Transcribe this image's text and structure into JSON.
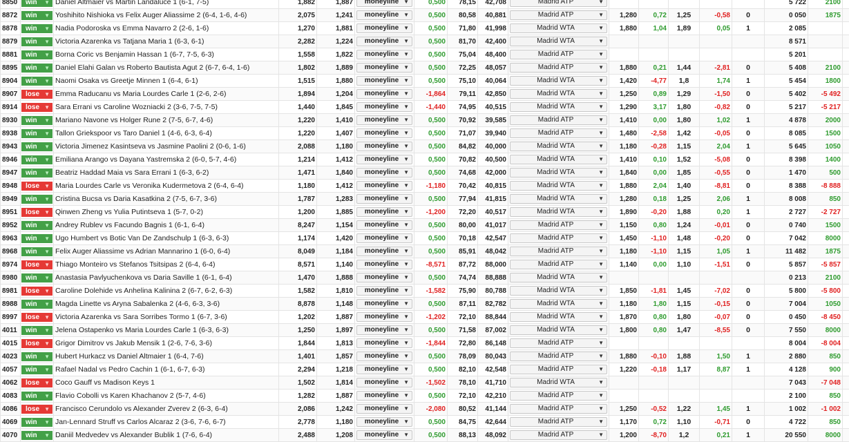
{
  "dropdown_icon": "chevron-down-icon",
  "colors": {
    "win": "#43a047",
    "lose": "#e53935",
    "positive": "#2e9b2e",
    "negative": "#e02020"
  },
  "rows": [
    {
      "id": "8850",
      "result": "win",
      "match": "Daniel Altmaier vs Martin Landaluce 1 (6-1, 7-5)",
      "a": "1,882",
      "b": "1,887",
      "market": "moneyline",
      "c": "0,500",
      "d": "78,15",
      "e": "42,708",
      "tournament": "Madrid ATP",
      "f": "",
      "g": "",
      "h": "",
      "i": "",
      "j": "",
      "k": "5 722",
      "l": "2100"
    },
    {
      "id": "8872",
      "result": "win",
      "match": "Yoshihito Nishioka vs Felix Auger Aliassime 2 (6-4, 1-6, 4-6)",
      "a": "2,075",
      "b": "1,241",
      "market": "moneyline",
      "c": "0,500",
      "d": "80,58",
      "e": "40,881",
      "tournament": "Madrid ATP",
      "f": "1,280",
      "g": "0,72",
      "h": "1,25",
      "i": "-0,58",
      "j": "0",
      "k": "0 050",
      "l": "1875"
    },
    {
      "id": "8878",
      "result": "win",
      "match": "Nadia Podoroska vs Emma Navarro 2 (2-6, 1-6)",
      "a": "1,270",
      "b": "1,881",
      "market": "moneyline",
      "c": "0,500",
      "d": "71,80",
      "e": "41,998",
      "tournament": "Madrid WTA",
      "f": "1,880",
      "g": "1,04",
      "h": "1,89",
      "i": "0,05",
      "j": "1",
      "k": "2 085",
      "l": ""
    },
    {
      "id": "8879",
      "result": "win",
      "match": "Victoria Azarenka vs Tatjana Maria 1 (6-3, 6-1)",
      "a": "2,282",
      "b": "1,224",
      "market": "moneyline",
      "c": "0,500",
      "d": "81,70",
      "e": "42,400",
      "tournament": "Madrid WTA",
      "f": "",
      "g": "",
      "h": "",
      "i": "",
      "j": "",
      "k": "8 571",
      "l": ""
    },
    {
      "id": "8881",
      "result": "win",
      "match": "Borna Coric vs Benjamin Hassan 1 (6-7, 7-5, 6-3)",
      "a": "1,558",
      "b": "1,822",
      "market": "moneyline",
      "c": "0,500",
      "d": "75,04",
      "e": "48,400",
      "tournament": "Madrid ATP",
      "f": "",
      "g": "",
      "h": "",
      "i": "",
      "j": "",
      "k": "5 201",
      "l": ""
    },
    {
      "id": "8895",
      "result": "win",
      "match": "Daniel Elahi Galan vs Roberto Bautista Agut 2 (6-7, 6-4, 1-6)",
      "a": "1,802",
      "b": "1,889",
      "market": "moneyline",
      "c": "0,500",
      "d": "72,25",
      "e": "48,057",
      "tournament": "Madrid ATP",
      "f": "1,880",
      "g": "0,21",
      "h": "1,44",
      "i": "-2,81",
      "j": "0",
      "k": "5 408",
      "l": "2100"
    },
    {
      "id": "8904",
      "result": "win",
      "match": "Naomi Osaka vs Greetje Minnen 1 (6-4, 6-1)",
      "a": "1,515",
      "b": "1,880",
      "market": "moneyline",
      "c": "0,500",
      "d": "75,10",
      "e": "40,064",
      "tournament": "Madrid WTA",
      "f": "1,420",
      "g": "-4,77",
      "h": "1,8",
      "i": "1,74",
      "j": "1",
      "k": "5 454",
      "l": "1800"
    },
    {
      "id": "8907",
      "result": "lose",
      "match": "Emma Raducanu vs Maria Lourdes Carle 1 (2-6, 2-6)",
      "a": "1,894",
      "b": "1,204",
      "market": "moneyline",
      "c": "-1,864",
      "d": "79,11",
      "e": "42,850",
      "tournament": "Madrid WTA",
      "f": "1,250",
      "g": "0,89",
      "h": "1,29",
      "i": "-1,50",
      "j": "0",
      "k": "5 402",
      "l": "-5 492"
    },
    {
      "id": "8914",
      "result": "lose",
      "match": "Sara Errani vs Caroline Wozniacki 2 (3-6, 7-5, 7-5)",
      "a": "1,440",
      "b": "1,845",
      "market": "moneyline",
      "c": "-1,440",
      "d": "74,95",
      "e": "40,515",
      "tournament": "Madrid WTA",
      "f": "1,290",
      "g": "3,17",
      "h": "1,80",
      "i": "-0,82",
      "j": "0",
      "k": "5 217",
      "l": "-5 217"
    },
    {
      "id": "8930",
      "result": "win",
      "match": "Mariano Navone vs Holger Rune 2 (7-5, 6-7, 4-6)",
      "a": "1,220",
      "b": "1,410",
      "market": "moneyline",
      "c": "0,500",
      "d": "70,92",
      "e": "39,585",
      "tournament": "Madrid ATP",
      "f": "1,410",
      "g": "0,00",
      "h": "1,80",
      "i": "1,02",
      "j": "1",
      "k": "4 878",
      "l": "2000"
    },
    {
      "id": "8938",
      "result": "win",
      "match": "Tallon Griekspoor vs Taro Daniel 1 (4-6, 6-3, 6-4)",
      "a": "1,220",
      "b": "1,407",
      "market": "moneyline",
      "c": "0,500",
      "d": "71,07",
      "e": "39,940",
      "tournament": "Madrid ATP",
      "f": "1,480",
      "g": "-2,58",
      "h": "1,42",
      "i": "-0,05",
      "j": "0",
      "k": "8 085",
      "l": "1500"
    },
    {
      "id": "8943",
      "result": "win",
      "match": "Victoria Jimenez Kasintseva vs Jasmine Paolini 2 (0-6, 1-6)",
      "a": "2,088",
      "b": "1,180",
      "market": "moneyline",
      "c": "0,500",
      "d": "84,82",
      "e": "40,000",
      "tournament": "Madrid WTA",
      "f": "1,180",
      "g": "-0,28",
      "h": "1,15",
      "i": "2,04",
      "j": "1",
      "k": "5 645",
      "l": "1050"
    },
    {
      "id": "8946",
      "result": "win",
      "match": "Emiliana Arango vs Dayana Yastremska 2 (6-0, 5-7, 4-6)",
      "a": "1,214",
      "b": "1,412",
      "market": "moneyline",
      "c": "0,500",
      "d": "70,82",
      "e": "40,500",
      "tournament": "Madrid WTA",
      "f": "1,410",
      "g": "0,10",
      "h": "1,52",
      "i": "-5,08",
      "j": "0",
      "k": "8 398",
      "l": "1400"
    },
    {
      "id": "8947",
      "result": "win",
      "match": "Beatriz Haddad Maia vs Sara Errani 1 (6-3, 6-2)",
      "a": "1,471",
      "b": "1,840",
      "market": "moneyline",
      "c": "0,500",
      "d": "74,68",
      "e": "42,000",
      "tournament": "Madrid WTA",
      "f": "1,840",
      "g": "0,00",
      "h": "1,85",
      "i": "-0,55",
      "j": "0",
      "k": "1 470",
      "l": "500"
    },
    {
      "id": "8948",
      "result": "lose",
      "match": "Maria Lourdes Carle vs Veronika Kudermetova 2 (6-4, 6-4)",
      "a": "1,180",
      "b": "1,412",
      "market": "moneyline",
      "c": "-1,180",
      "d": "70,42",
      "e": "40,815",
      "tournament": "Madrid WTA",
      "f": "1,880",
      "g": "2,04",
      "h": "1,40",
      "i": "-8,81",
      "j": "0",
      "k": "8 388",
      "l": "-8 888"
    },
    {
      "id": "8949",
      "result": "win",
      "match": "Cristina Bucsa vs Daria Kasatkina 2 (7-5, 6-7, 3-6)",
      "a": "1,787",
      "b": "1,283",
      "market": "moneyline",
      "c": "0,500",
      "d": "77,94",
      "e": "41,815",
      "tournament": "Madrid WTA",
      "f": "1,280",
      "g": "0,18",
      "h": "1,25",
      "i": "2,06",
      "j": "1",
      "k": "8 008",
      "l": "850"
    },
    {
      "id": "8951",
      "result": "lose",
      "match": "Qinwen Zheng vs Yulia Putintseva 1 (5-7, 0-2)",
      "a": "1,200",
      "b": "1,885",
      "market": "moneyline",
      "c": "-1,200",
      "d": "72,20",
      "e": "40,517",
      "tournament": "Madrid WTA",
      "f": "1,890",
      "g": "-0,20",
      "h": "1,88",
      "i": "0,20",
      "j": "1",
      "k": "2 727",
      "l": "-2 727"
    },
    {
      "id": "8952",
      "result": "win",
      "match": "Andrey Rublev vs Facundo Bagnis 1 (6-1, 6-4)",
      "a": "8,247",
      "b": "1,154",
      "market": "moneyline",
      "c": "0,500",
      "d": "80,00",
      "e": "41,017",
      "tournament": "Madrid ATP",
      "f": "1,150",
      "g": "0,80",
      "h": "1,24",
      "i": "-0,01",
      "j": "0",
      "k": "0 740",
      "l": "1500"
    },
    {
      "id": "8963",
      "result": "win",
      "match": "Ugo Humbert vs Botic Van De Zandschulp 1 (6-3, 6-3)",
      "a": "1,174",
      "b": "1,420",
      "market": "moneyline",
      "c": "0,500",
      "d": "70,18",
      "e": "42,547",
      "tournament": "Madrid ATP",
      "f": "1,450",
      "g": "-1,10",
      "h": "1,48",
      "i": "-0,20",
      "j": "0",
      "k": "7 042",
      "l": "8000"
    },
    {
      "id": "8968",
      "result": "win",
      "match": "Felix Auger Aliassime vs Adrian Mannarino 1 (6-0, 6-4)",
      "a": "8,049",
      "b": "1,184",
      "market": "moneyline",
      "c": "0,500",
      "d": "85,91",
      "e": "48,042",
      "tournament": "Madrid ATP",
      "f": "1,180",
      "g": "-1,10",
      "h": "1,15",
      "i": "1,05",
      "j": "1",
      "k": "11 482",
      "l": "1875"
    },
    {
      "id": "8974",
      "result": "lose",
      "match": "Thiago Monteiro vs Stefanos Tsitsipas 2 (6-4, 6-4)",
      "a": "8,571",
      "b": "1,140",
      "market": "moneyline",
      "c": "-8,571",
      "d": "87,72",
      "e": "88,000",
      "tournament": "Madrid ATP",
      "f": "1,140",
      "g": "0,00",
      "h": "1,10",
      "i": "-1,51",
      "j": "0",
      "k": "5 857",
      "l": "-5 857"
    },
    {
      "id": "8980",
      "result": "win",
      "match": "Anastasia Pavlyuchenkova vs Daria Saville 1 (6-1, 6-4)",
      "a": "1,470",
      "b": "1,888",
      "market": "moneyline",
      "c": "0,500",
      "d": "74,74",
      "e": "88,888",
      "tournament": "Madrid WTA",
      "f": "",
      "g": "",
      "h": "",
      "i": "",
      "j": "",
      "k": "0 213",
      "l": "2100"
    },
    {
      "id": "8981",
      "result": "lose",
      "match": "Caroline Dolehide vs Anhelina Kalinina 2 (6-7, 6-2, 6-3)",
      "a": "1,582",
      "b": "1,810",
      "market": "moneyline",
      "c": "-1,582",
      "d": "75,90",
      "e": "80,788",
      "tournament": "Madrid WTA",
      "f": "1,850",
      "g": "-1,81",
      "h": "1,45",
      "i": "-7,02",
      "j": "0",
      "k": "5 800",
      "l": "-5 800"
    },
    {
      "id": "8988",
      "result": "win",
      "match": "Magda Linette vs Aryna Sabalenka 2 (4-6, 6-3, 3-6)",
      "a": "8,878",
      "b": "1,148",
      "market": "moneyline",
      "c": "0,500",
      "d": "87,11",
      "e": "82,782",
      "tournament": "Madrid WTA",
      "f": "1,180",
      "g": "1,80",
      "h": "1,15",
      "i": "-0,15",
      "j": "0",
      "k": "7 004",
      "l": "1050"
    },
    {
      "id": "8997",
      "result": "lose",
      "match": "Victoria Azarenka vs Sara Sorribes Tormo 1 (6-7, 3-6)",
      "a": "1,202",
      "b": "1,887",
      "market": "moneyline",
      "c": "-1,202",
      "d": "72,10",
      "e": "88,844",
      "tournament": "Madrid WTA",
      "f": "1,870",
      "g": "0,80",
      "h": "1,80",
      "i": "-0,07",
      "j": "0",
      "k": "0 450",
      "l": "-8 450"
    },
    {
      "id": "4011",
      "result": "win",
      "match": "Jelena Ostapenko vs Maria Lourdes Carle 1 (6-3, 6-3)",
      "a": "1,250",
      "b": "1,897",
      "market": "moneyline",
      "c": "0,500",
      "d": "71,58",
      "e": "87,002",
      "tournament": "Madrid WTA",
      "f": "1,800",
      "g": "0,80",
      "h": "1,47",
      "i": "-8,55",
      "j": "0",
      "k": "7 550",
      "l": "8000"
    },
    {
      "id": "4015",
      "result": "lose",
      "match": "Grigor Dimitrov vs Jakub Mensik 1 (2-6, 7-6, 3-6)",
      "a": "1,844",
      "b": "1,813",
      "market": "moneyline",
      "c": "-1,844",
      "d": "72,80",
      "e": "86,148",
      "tournament": "Madrid ATP",
      "f": "",
      "g": "",
      "h": "",
      "i": "",
      "j": "",
      "k": "8 004",
      "l": "-8 004"
    },
    {
      "id": "4023",
      "result": "win",
      "match": "Hubert Hurkacz vs Daniel Altmaier 1 (6-4, 7-6)",
      "a": "1,401",
      "b": "1,857",
      "market": "moneyline",
      "c": "0,500",
      "d": "78,09",
      "e": "80,043",
      "tournament": "Madrid ATP",
      "f": "1,880",
      "g": "-0,10",
      "h": "1,88",
      "i": "1,50",
      "j": "1",
      "k": "2 880",
      "l": "850"
    },
    {
      "id": "4057",
      "result": "win",
      "match": "Rafael Nadal vs Pedro Cachin 1 (6-1, 6-7, 6-3)",
      "a": "2,294",
      "b": "1,218",
      "market": "moneyline",
      "c": "0,500",
      "d": "82,10",
      "e": "42,548",
      "tournament": "Madrid ATP",
      "f": "1,220",
      "g": "-0,18",
      "h": "1,17",
      "i": "8,87",
      "j": "1",
      "k": "4 128",
      "l": "900"
    },
    {
      "id": "4062",
      "result": "lose",
      "match": "Coco Gauff vs Madison Keys 1",
      "a": "1,502",
      "b": "1,814",
      "market": "moneyline",
      "c": "-1,502",
      "d": "78,10",
      "e": "41,710",
      "tournament": "Madrid WTA",
      "f": "",
      "g": "",
      "h": "",
      "i": "",
      "j": "",
      "k": "7 043",
      "l": "-7 048"
    },
    {
      "id": "4083",
      "result": "win",
      "match": "Flavio Cobolli vs Karen Khachanov 2 (5-7, 4-6)",
      "a": "1,282",
      "b": "1,887",
      "market": "moneyline",
      "c": "0,500",
      "d": "72,10",
      "e": "42,210",
      "tournament": "Madrid ATP",
      "f": "",
      "g": "",
      "h": "",
      "i": "",
      "j": "",
      "k": "2 100",
      "l": "850"
    },
    {
      "id": "4086",
      "result": "lose",
      "match": "Francisco Cerundolo vs Alexander Zverev 2 (6-3, 6-4)",
      "a": "2,086",
      "b": "1,242",
      "market": "moneyline",
      "c": "-2,080",
      "d": "80,52",
      "e": "41,144",
      "tournament": "Madrid ATP",
      "f": "1,250",
      "g": "-0,52",
      "h": "1,22",
      "i": "1,45",
      "j": "1",
      "k": "1 002",
      "l": "-1 002"
    },
    {
      "id": "4069",
      "result": "win",
      "match": "Jan-Lennard Struff vs Carlos Alcaraz 2 (3-6, 7-6, 6-7)",
      "a": "2,778",
      "b": "1,180",
      "market": "moneyline",
      "c": "0,500",
      "d": "84,75",
      "e": "42,644",
      "tournament": "Madrid ATP",
      "f": "1,170",
      "g": "0,72",
      "h": "1,10",
      "i": "-0,71",
      "j": "0",
      "k": "4 722",
      "l": "850"
    },
    {
      "id": "4070",
      "result": "win",
      "match": "Daniil Medvedev vs Alexander Bublik 1 (7-6, 6-4)",
      "a": "2,488",
      "b": "1,208",
      "market": "moneyline",
      "c": "0,500",
      "d": "88,13",
      "e": "48,092",
      "tournament": "Madrid ATP",
      "f": "1,200",
      "g": "-8,70",
      "h": "1,2",
      "i": "0,21",
      "j": "1",
      "k": "20 550",
      "l": "8000"
    }
  ]
}
